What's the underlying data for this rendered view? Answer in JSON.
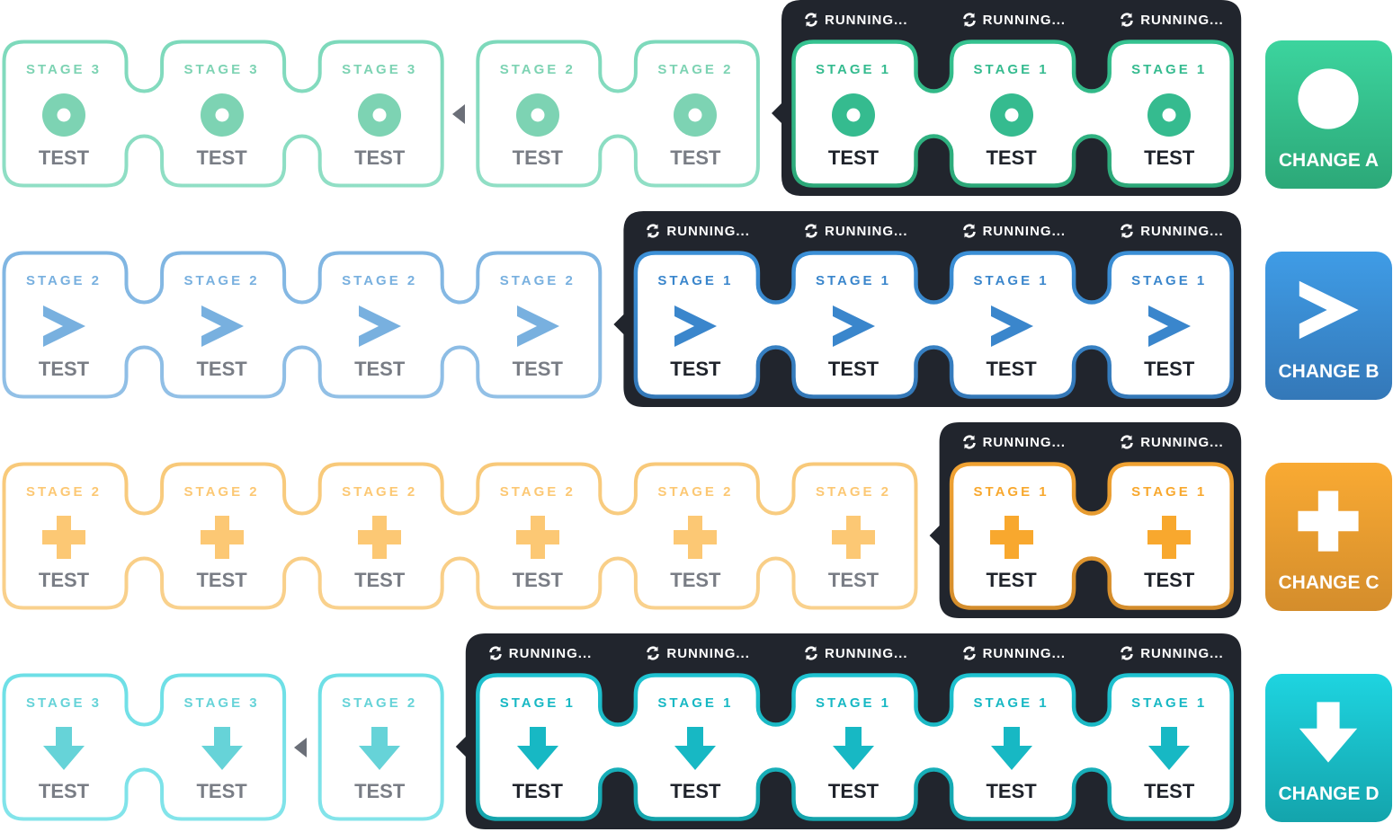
{
  "pipeline_rows": [
    {
      "id": "a",
      "icon": "target-ring-icon",
      "colors": {
        "old_stroke": "#7dd9bb",
        "run_stroke": "#35c290",
        "old_icon": "#7dd3b3",
        "run_icon": "#35bb8f",
        "badge_top": "#3cd49e",
        "badge_bottom": "#2ca878"
      },
      "change": {
        "label": "CHANGE A"
      },
      "groups": [
        {
          "tiles": [
            {
              "stage": "STAGE 3",
              "name": "TEST"
            },
            {
              "stage": "STAGE 3",
              "name": "TEST"
            },
            {
              "stage": "STAGE 3",
              "name": "TEST"
            }
          ]
        },
        {
          "tiles": [
            {
              "stage": "STAGE 2",
              "name": "TEST"
            },
            {
              "stage": "STAGE 2",
              "name": "TEST"
            }
          ]
        }
      ],
      "running": {
        "tiles": [
          {
            "stage": "STAGE 1",
            "name": "TEST",
            "status": "RUNNING..."
          },
          {
            "stage": "STAGE 1",
            "name": "TEST",
            "status": "RUNNING..."
          },
          {
            "stage": "STAGE 1",
            "name": "TEST",
            "status": "RUNNING..."
          }
        ]
      }
    },
    {
      "id": "b",
      "icon": "chevron-right-icon",
      "colors": {
        "old_stroke": "#7fb5e2",
        "run_stroke": "#3b8fd6",
        "old_icon": "#78b0df",
        "run_icon": "#3a86cc",
        "badge_top": "#3f9ce6",
        "badge_bottom": "#3478b8"
      },
      "change": {
        "label": "CHANGE B"
      },
      "groups": [
        {
          "tiles": [
            {
              "stage": "STAGE 2",
              "name": "TEST"
            },
            {
              "stage": "STAGE 2",
              "name": "TEST"
            },
            {
              "stage": "STAGE 2",
              "name": "TEST"
            },
            {
              "stage": "STAGE 2",
              "name": "TEST"
            }
          ]
        }
      ],
      "running": {
        "tiles": [
          {
            "stage": "STAGE 1",
            "name": "TEST",
            "status": "RUNNING..."
          },
          {
            "stage": "STAGE 1",
            "name": "TEST",
            "status": "RUNNING..."
          },
          {
            "stage": "STAGE 1",
            "name": "TEST",
            "status": "RUNNING..."
          },
          {
            "stage": "STAGE 1",
            "name": "TEST",
            "status": "RUNNING..."
          }
        ]
      }
    },
    {
      "id": "c",
      "icon": "plus-icon",
      "colors": {
        "old_stroke": "#f8c979",
        "run_stroke": "#f0a232",
        "old_icon": "#fcc874",
        "run_icon": "#f8a82e",
        "badge_top": "#f9aa33",
        "badge_bottom": "#d48d2c"
      },
      "change": {
        "label": "CHANGE C"
      },
      "groups": [
        {
          "tiles": [
            {
              "stage": "STAGE 2",
              "name": "TEST"
            },
            {
              "stage": "STAGE 2",
              "name": "TEST"
            },
            {
              "stage": "STAGE 2",
              "name": "TEST"
            },
            {
              "stage": "STAGE 2",
              "name": "TEST"
            },
            {
              "stage": "STAGE 2",
              "name": "TEST"
            },
            {
              "stage": "STAGE 2",
              "name": "TEST"
            }
          ]
        }
      ],
      "running": {
        "tiles": [
          {
            "stage": "STAGE 1",
            "name": "TEST",
            "status": "RUNNING..."
          },
          {
            "stage": "STAGE 1",
            "name": "TEST",
            "status": "RUNNING..."
          }
        ]
      }
    },
    {
      "id": "d",
      "icon": "arrow-down-icon",
      "colors": {
        "old_stroke": "#6ddfe6",
        "run_stroke": "#1ec2d0",
        "old_icon": "#66d3d8",
        "run_icon": "#17b8c4",
        "badge_top": "#1ed4e0",
        "badge_bottom": "#14a4ac"
      },
      "change": {
        "label": "CHANGE D"
      },
      "groups": [
        {
          "tiles": [
            {
              "stage": "STAGE 3",
              "name": "TEST"
            },
            {
              "stage": "STAGE 3",
              "name": "TEST"
            }
          ]
        },
        {
          "tiles": [
            {
              "stage": "STAGE 2",
              "name": "TEST"
            }
          ]
        }
      ],
      "running": {
        "tiles": [
          {
            "stage": "STAGE 1",
            "name": "TEST",
            "status": "RUNNING..."
          },
          {
            "stage": "STAGE 1",
            "name": "TEST",
            "status": "RUNNING..."
          },
          {
            "stage": "STAGE 1",
            "name": "TEST",
            "status": "RUNNING..."
          },
          {
            "stage": "STAGE 1",
            "name": "TEST",
            "status": "RUNNING..."
          },
          {
            "stage": "STAGE 1",
            "name": "TEST",
            "status": "RUNNING..."
          }
        ]
      }
    }
  ],
  "theme": {
    "panel_bg": "#21252d",
    "separator": "#6b6f78",
    "muted_text": "#6b6f78"
  }
}
